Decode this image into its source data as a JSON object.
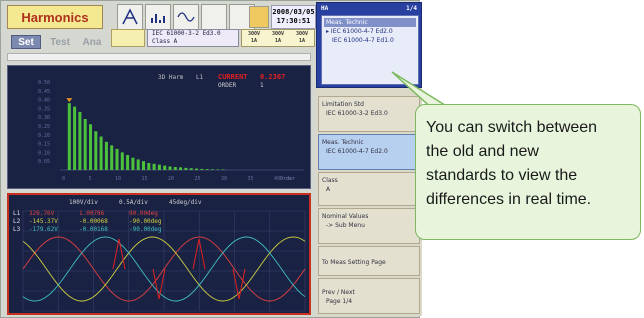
{
  "header": {
    "title": "Harmonics",
    "datetime": [
      "2008/03/05",
      "17:30:51"
    ],
    "tabs": [
      "Set",
      "Test",
      "Ana"
    ],
    "standard_line1": "IEC 61000-3-2 Ed3.0",
    "standard_line2": "Class A",
    "voltages": [
      {
        "top": "300V",
        "bot": "1A"
      },
      {
        "top": "300V",
        "bot": "1A"
      },
      {
        "top": "300V",
        "bot": "1A"
      }
    ]
  },
  "harmonics_graph": {
    "mode_label": "3D Harm",
    "channel": "L1",
    "current_label": "CURRENT",
    "current_value": "0.2367",
    "order_label": "ORDER",
    "order_value": "1",
    "y_ticks": [
      "0.50",
      "0.45",
      "0.40",
      "0.35",
      "0.30",
      "0.25",
      "0.20",
      "0.15",
      "0.10",
      "0.05"
    ],
    "x_axis_label": "Order",
    "x_ticks": [
      "0",
      "5",
      "10",
      "15",
      "20",
      "25",
      "30",
      "35",
      "40"
    ],
    "bar_values": [
      0.38,
      0.36,
      0.33,
      0.29,
      0.26,
      0.22,
      0.19,
      0.16,
      0.14,
      0.12,
      0.1,
      0.085,
      0.07,
      0.06,
      0.05,
      0.04,
      0.035,
      0.03,
      0.025,
      0.02,
      0.017,
      0.015,
      0.012,
      0.01,
      0.008,
      0.006,
      0.005,
      0.004,
      0.003,
      0.003
    ],
    "colors": {
      "bar": "#4cc23c",
      "marker": "#e89020",
      "current": "#e02020"
    }
  },
  "waveform_graph": {
    "scales": [
      "100V/div",
      "0.5A/div",
      "45deg/div"
    ],
    "rows": [
      {
        "ch": "L1",
        "v": "326.76V",
        "a": "1.00786",
        "deg": "90.00deg",
        "color": "#e04040"
      },
      {
        "ch": "L2",
        "v": "-145.37V",
        "a": "-0.00068",
        "deg": "-90.00deg",
        "color": "#d0d040"
      },
      {
        "ch": "L3",
        "v": "-179.62V",
        "a": "-0.00168",
        "deg": "-90.00deg",
        "color": "#40c0c0"
      }
    ]
  },
  "right_panel": {
    "header": "HA",
    "page": "1/4",
    "measure_title": "Meas. Technic",
    "measure_options": [
      "IEC 61000-4-7 Ed2.0",
      "IEC 61000-4-7 Ed1.0"
    ],
    "limitation_label": "Limitation Std",
    "limitation_value": "IEC 61000-3-2 Ed3.0",
    "meas_tech_label": "Meas. Technic",
    "meas_tech_value": "IEC 61000-4-7 Ed2.0",
    "class_label": "Class",
    "class_value": "A",
    "nominal_label": "Nominal Values",
    "nominal_value": "-> Sub Menu",
    "to_meas_label": "To Meas Setting Page",
    "prev_next_label": "Prev / Next",
    "prev_next_value": "Page 1/4"
  },
  "callout": {
    "lines": [
      "You can switch between",
      "the old and new",
      "standards to view the",
      "differences in real time."
    ]
  }
}
